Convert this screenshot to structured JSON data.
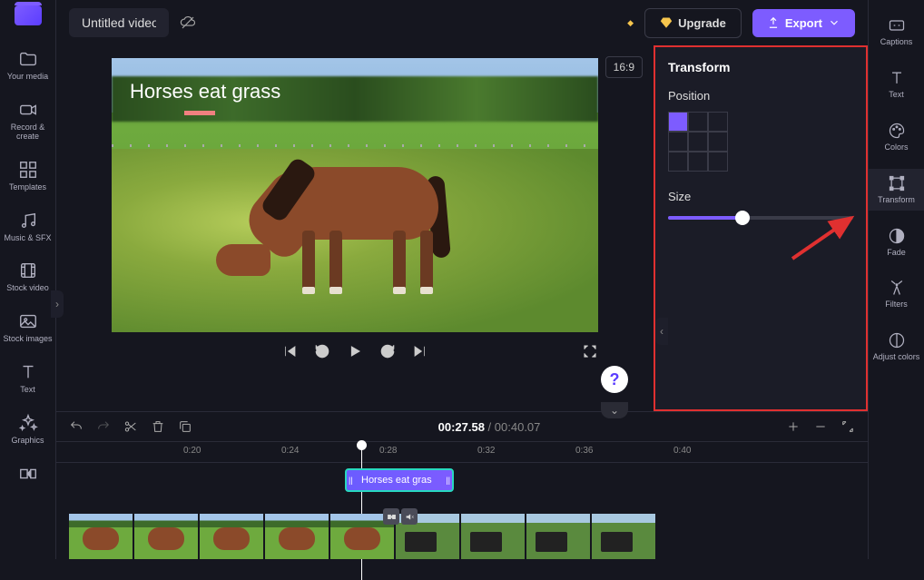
{
  "header": {
    "title": "Untitled video",
    "upgrade_label": "Upgrade",
    "export_label": "Export",
    "aspect_ratio": "16:9"
  },
  "left_sidebar": {
    "items": [
      {
        "label": "Your media"
      },
      {
        "label": "Record & create"
      },
      {
        "label": "Templates"
      },
      {
        "label": "Music & SFX"
      },
      {
        "label": "Stock video"
      },
      {
        "label": "Stock images"
      },
      {
        "label": "Text"
      },
      {
        "label": "Graphics"
      }
    ]
  },
  "right_sidebar": {
    "items": [
      {
        "label": "Captions"
      },
      {
        "label": "Text"
      },
      {
        "label": "Colors"
      },
      {
        "label": "Transform",
        "active": true
      },
      {
        "label": "Fade"
      },
      {
        "label": "Filters"
      },
      {
        "label": "Adjust colors"
      }
    ]
  },
  "canvas": {
    "caption_text": "Horses eat grass"
  },
  "transform_panel": {
    "title": "Transform",
    "position_label": "Position",
    "size_label": "Size",
    "selected_position": 0,
    "size_value": 40
  },
  "timeline": {
    "current_time": "00:27.58",
    "duration": "00:40.07",
    "ticks": [
      "0:20",
      "0:24",
      "0:28",
      "0:32",
      "0:36",
      "0:40"
    ],
    "text_clip_label": "Horses eat gras"
  }
}
